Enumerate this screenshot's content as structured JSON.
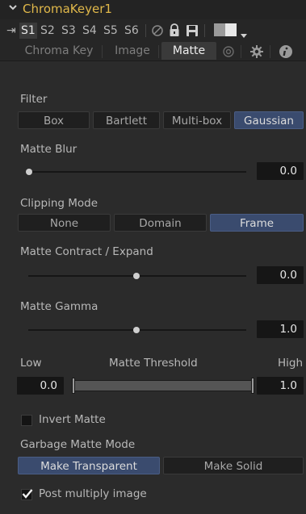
{
  "title": {
    "chevron": "chevron-down-icon",
    "node_name": "ChromaKeyer1"
  },
  "toolbar": {
    "pin_glyph": "⇥",
    "scenes": [
      "S1",
      "S2",
      "S3",
      "S4",
      "S5",
      "S6"
    ],
    "active_scene": "S1"
  },
  "tabs": [
    "Chroma Key",
    "Image",
    "Matte"
  ],
  "active_tab": "Matte",
  "filter": {
    "label": "Filter",
    "options": [
      "Box",
      "Bartlett",
      "Multi-box",
      "Gaussian"
    ],
    "selected": "Gaussian"
  },
  "matte_blur": {
    "label": "Matte Blur",
    "value": "0.0",
    "level": 0.0
  },
  "clipping_mode": {
    "label": "Clipping Mode",
    "options": [
      "None",
      "Domain",
      "Frame"
    ],
    "selected": "Frame"
  },
  "matte_contract": {
    "label": "Matte Contract / Expand",
    "value": "0.0",
    "level": 0.5
  },
  "matte_gamma": {
    "label": "Matte Gamma",
    "value": "1.0",
    "level": 0.5
  },
  "matte_threshold": {
    "label": "Matte Threshold",
    "low_label": "Low",
    "high_label": "High",
    "low_value": "0.0",
    "high_value": "1.0"
  },
  "invert_matte": {
    "label": "Invert Matte",
    "checked": false
  },
  "garbage_matte_mode": {
    "label": "Garbage Matte Mode",
    "options": [
      "Make Transparent",
      "Make Solid"
    ],
    "selected": "Make Transparent"
  },
  "post_multiply": {
    "label": "Post multiply image",
    "checked": true
  },
  "colors": {
    "accent": "#3a4b6e",
    "title": "#e0b84a",
    "background": "#2b2b2b"
  }
}
